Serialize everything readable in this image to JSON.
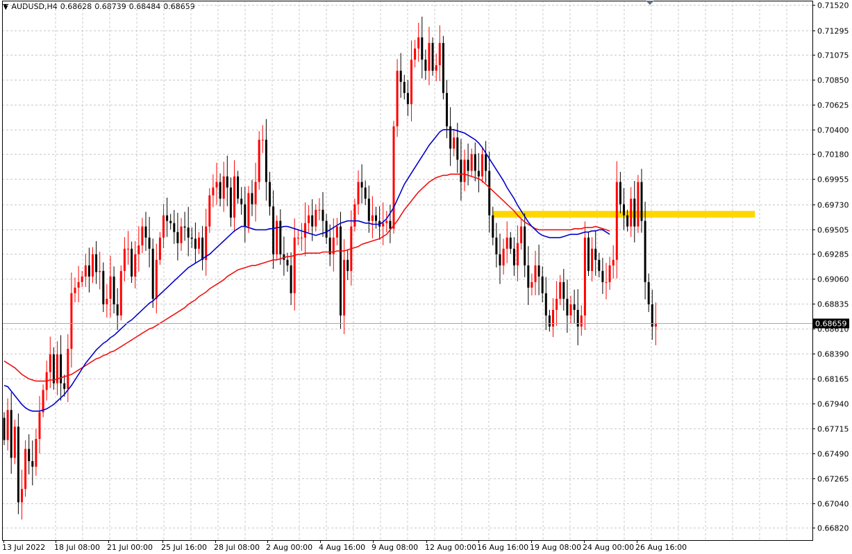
{
  "header": {
    "symbol_tf": "AUDUSD,H4",
    "open": "0.68628",
    "high": "0.68739",
    "low": "0.68484",
    "close": "0.68659"
  },
  "colors": {
    "bull": "#ff0000",
    "bear": "#000000",
    "ma_fast": "#0000cc",
    "ma_slow": "#ee1111",
    "zone": "#ffd700",
    "grid": "#c8c8c8",
    "price_line": "#a0a8b0"
  },
  "chart_data": {
    "type": "candlestick",
    "symbol": "AUDUSD",
    "timeframe": "H4",
    "ylim": [
      0.6671,
      0.7156
    ],
    "grid": true,
    "y_ticks": [
      "0.71520",
      "0.71295",
      "0.71075",
      "0.70850",
      "0.70625",
      "0.70400",
      "0.70180",
      "0.69955",
      "0.69730",
      "0.69505",
      "0.69285",
      "0.69060",
      "0.68835",
      "0.68610",
      "0.68390",
      "0.68165",
      "0.67940",
      "0.67715",
      "0.67490",
      "0.67265",
      "0.67040",
      "0.66820"
    ],
    "x_ticks": [
      "13 Jul 2022",
      "18 Jul 08:00",
      "21 Jul 00:00",
      "25 Jul 16:00",
      "28 Jul 08:00",
      "2 Aug 00:00",
      "4 Aug 16:00",
      "9 Aug 08:00",
      "12 Aug 00:00",
      "16 Aug 16:00",
      "19 Aug 08:00",
      "24 Aug 00:00",
      "26 Aug 16:00"
    ],
    "current_price": "0.68659",
    "resistance_zone": {
      "low": 0.6961,
      "high": 0.6967,
      "from_bar": 138,
      "to_bar": 212
    },
    "closes": [
      0.6761,
      0.6788,
      0.6745,
      0.6773,
      0.6705,
      0.6717,
      0.6753,
      0.6742,
      0.6737,
      0.6762,
      0.6786,
      0.6806,
      0.6822,
      0.6838,
      0.6812,
      0.6838,
      0.6812,
      0.6807,
      0.6843,
      0.6893,
      0.6898,
      0.6903,
      0.6908,
      0.6918,
      0.6908,
      0.6928,
      0.6912,
      0.6913,
      0.6883,
      0.6888,
      0.6908,
      0.6883,
      0.6873,
      0.6913,
      0.6933,
      0.6933,
      0.6908,
      0.6928,
      0.6936,
      0.6953,
      0.6943,
      0.6933,
      0.6888,
      0.6923,
      0.6943,
      0.6963,
      0.6958,
      0.6956,
      0.6948,
      0.6938,
      0.6953,
      0.6952,
      0.6943,
      0.6942,
      0.6933,
      0.6943,
      0.6923,
      0.6953,
      0.6981,
      0.6988,
      0.6993,
      0.6978,
      0.6998,
      0.6988,
      0.6961,
      0.6998,
      0.6978,
      0.6973,
      0.6953,
      0.6983,
      0.6973,
      0.6993,
      0.7031,
      0.7031,
      0.6993,
      0.6971,
      0.6928,
      0.6958,
      0.6928,
      0.6923,
      0.6918,
      0.6893,
      0.6943,
      0.6943,
      0.6943,
      0.6956,
      0.6963,
      0.6953,
      0.6968,
      0.6968,
      0.6958,
      0.6943,
      0.6928,
      0.6943,
      0.6953,
      0.6873,
      0.6923,
      0.6913,
      0.6953,
      0.6973,
      0.6993,
      0.6988,
      0.6978,
      0.6958,
      0.6963,
      0.6958,
      0.6953,
      0.6956,
      0.6958,
      0.6951,
      0.7043,
      0.7093,
      0.7083,
      0.7073,
      0.7063,
      0.7103,
      0.7113,
      0.7123,
      0.7103,
      0.7093,
      0.7118,
      0.7093,
      0.7098,
      0.7118,
      0.7073,
      0.7043,
      0.7023,
      0.7033,
      0.7013,
      0.6993,
      0.7013,
      0.7003,
      0.7018,
      0.7003,
      0.6998,
      0.7018,
      0.7003,
      0.6963,
      0.6943,
      0.6928,
      0.6918,
      0.6933,
      0.6943,
      0.6933,
      0.6918,
      0.6938,
      0.6953,
      0.6918,
      0.6898,
      0.6903,
      0.6918,
      0.6908,
      0.6893,
      0.6873,
      0.6863,
      0.6878,
      0.6888,
      0.6903,
      0.6888,
      0.6873,
      0.6883,
      0.6878,
      0.6863,
      0.6873,
      0.6943,
      0.6913,
      0.6933,
      0.6923,
      0.6913,
      0.6903,
      0.6903,
      0.6918,
      0.6923,
      0.6993,
      0.6973,
      0.6963,
      0.6953,
      0.6978,
      0.6953,
      0.6993,
      0.6958,
      0.6903,
      0.6883,
      0.6863,
      0.6866
    ],
    "ma_fast": [
      0.681,
      0.6809,
      0.6805,
      0.6801,
      0.6797,
      0.6793,
      0.679,
      0.6788,
      0.6787,
      0.6787,
      0.6787,
      0.6788,
      0.6789,
      0.6791,
      0.6793,
      0.6796,
      0.6799,
      0.6802,
      0.6806,
      0.681,
      0.6815,
      0.682,
      0.6825,
      0.683,
      0.6834,
      0.6838,
      0.6842,
      0.6845,
      0.6848,
      0.685,
      0.6853,
      0.6855,
      0.6858,
      0.6861,
      0.6864,
      0.6867,
      0.6869,
      0.6872,
      0.6875,
      0.6878,
      0.6881,
      0.6884,
      0.6886,
      0.6889,
      0.6892,
      0.6895,
      0.6898,
      0.6901,
      0.6904,
      0.6907,
      0.691,
      0.6913,
      0.6916,
      0.6918,
      0.692,
      0.6922,
      0.6924,
      0.6926,
      0.6928,
      0.6931,
      0.6934,
      0.6937,
      0.694,
      0.6943,
      0.6946,
      0.6949,
      0.6951,
      0.6953,
      0.6953,
      0.6952,
      0.6951,
      0.695,
      0.695,
      0.695,
      0.695,
      0.6951,
      0.6951,
      0.6952,
      0.6952,
      0.6953,
      0.6953,
      0.6952,
      0.6951,
      0.695,
      0.6949,
      0.6948,
      0.6947,
      0.6946,
      0.6945,
      0.6946,
      0.6947,
      0.6948,
      0.695,
      0.6952,
      0.6954,
      0.6956,
      0.6957,
      0.6958,
      0.6958,
      0.6958,
      0.6958,
      0.6957,
      0.6956,
      0.6956,
      0.6955,
      0.6955,
      0.6955,
      0.6957,
      0.696,
      0.6965,
      0.697,
      0.6977,
      0.6984,
      0.6991,
      0.6996,
      0.7001,
      0.7006,
      0.7011,
      0.7016,
      0.7021,
      0.7026,
      0.703,
      0.7034,
      0.7038,
      0.704,
      0.704,
      0.704,
      0.704,
      0.7039,
      0.7038,
      0.7037,
      0.7035,
      0.7033,
      0.7031,
      0.7028,
      0.7024,
      0.7019,
      0.7014,
      0.7009,
      0.7004,
      0.6999,
      0.6994,
      0.6988,
      0.6983,
      0.6978,
      0.6972,
      0.6967,
      0.6962,
      0.6957,
      0.6953,
      0.695,
      0.6947,
      0.6945,
      0.6944,
      0.6943,
      0.6943,
      0.6943,
      0.6943,
      0.6944,
      0.6945,
      0.6946,
      0.6946,
      0.6946,
      0.6947,
      0.6948,
      0.6948,
      0.6949,
      0.6949,
      0.695,
      0.695,
      0.6948,
      0.6946
    ],
    "ma_slow": [
      0.6832,
      0.683,
      0.6828,
      0.6826,
      0.6823,
      0.682,
      0.6818,
      0.6816,
      0.6815,
      0.6814,
      0.6814,
      0.6814,
      0.6814,
      0.6815,
      0.6815,
      0.6816,
      0.6817,
      0.6818,
      0.6819,
      0.682,
      0.6822,
      0.6824,
      0.6826,
      0.6828,
      0.683,
      0.6832,
      0.6834,
      0.6835,
      0.6837,
      0.6838,
      0.684,
      0.6841,
      0.6843,
      0.6845,
      0.6847,
      0.6849,
      0.6851,
      0.6853,
      0.6855,
      0.6857,
      0.6859,
      0.6861,
      0.6862,
      0.6864,
      0.6866,
      0.6868,
      0.687,
      0.6872,
      0.6874,
      0.6876,
      0.6878,
      0.688,
      0.6883,
      0.6885,
      0.6887,
      0.689,
      0.6892,
      0.6894,
      0.6897,
      0.6899,
      0.6901,
      0.6903,
      0.6905,
      0.6908,
      0.691,
      0.6912,
      0.6914,
      0.6915,
      0.6916,
      0.6917,
      0.6918,
      0.6918,
      0.6919,
      0.692,
      0.6921,
      0.6922,
      0.6923,
      0.6923,
      0.6924,
      0.6925,
      0.6926,
      0.6926,
      0.6927,
      0.6928,
      0.6928,
      0.6929,
      0.6929,
      0.6929,
      0.6929,
      0.6929,
      0.693,
      0.693,
      0.693,
      0.693,
      0.6931,
      0.6931,
      0.6931,
      0.6932,
      0.6933,
      0.6934,
      0.6935,
      0.6937,
      0.6938,
      0.6939,
      0.694,
      0.6941,
      0.6942,
      0.6944,
      0.6946,
      0.695,
      0.6954,
      0.6958,
      0.6963,
      0.6968,
      0.6972,
      0.6976,
      0.698,
      0.6984,
      0.6987,
      0.699,
      0.6993,
      0.6995,
      0.6997,
      0.6998,
      0.6999,
      0.6999,
      0.7,
      0.7,
      0.7,
      0.7,
      0.7,
      0.6999,
      0.6998,
      0.6997,
      0.6996,
      0.6994,
      0.6991,
      0.6988,
      0.6985,
      0.6982,
      0.6979,
      0.6976,
      0.6973,
      0.697,
      0.6967,
      0.6963,
      0.696,
      0.6957,
      0.6955,
      0.6953,
      0.6951,
      0.695,
      0.695,
      0.695,
      0.695,
      0.695,
      0.695,
      0.695,
      0.695,
      0.695,
      0.695,
      0.6951,
      0.6951,
      0.6951,
      0.6952,
      0.6952,
      0.6952,
      0.6953,
      0.6952,
      0.6951,
      0.695,
      0.6949
    ]
  }
}
